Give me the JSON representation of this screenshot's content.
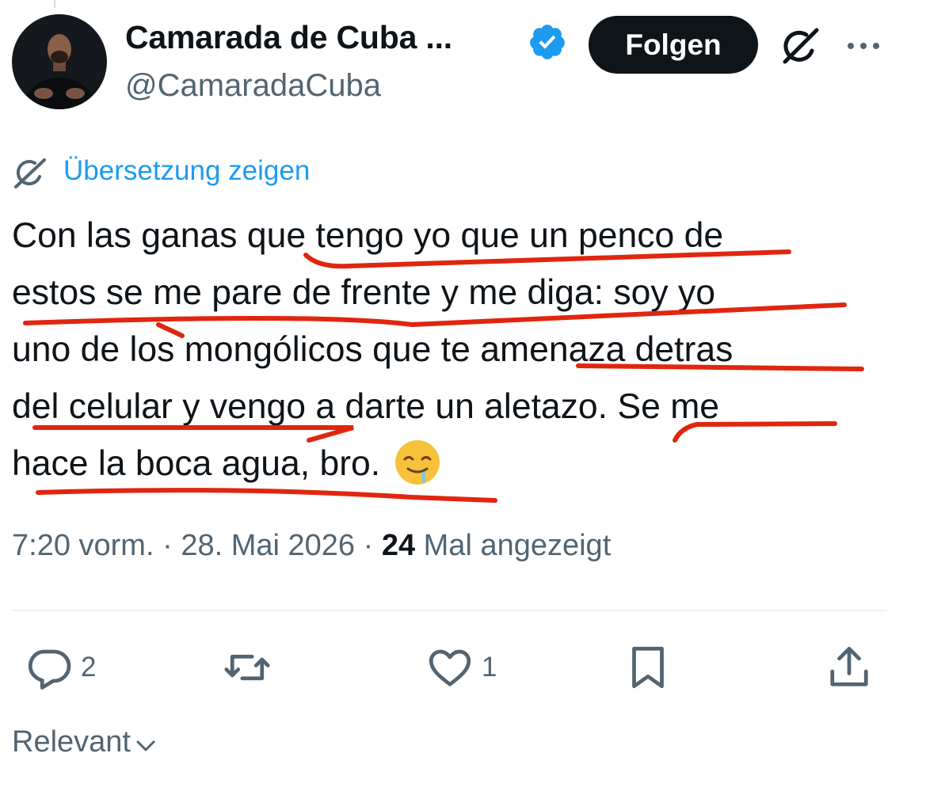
{
  "author": {
    "display_name": "Camarada de Cuba ...",
    "handle": "@CamaradaCuba",
    "verified": true
  },
  "follow_button": {
    "label": "Folgen"
  },
  "translate_link": "Übersetzung zeigen",
  "tweet": {
    "text": "Con las ganas que tengo yo que un penco de\nestos se me pare de frente y me diga: soy yo\nuno de los mongólicos que te amenaza detras\ndel celular y vengo a darte un aletazo. Se me\nhace la boca agua, bro.",
    "emoji": "drooling-face"
  },
  "meta": {
    "time": "7:20 vorm.",
    "separator": "·",
    "date": "28. Mai 2026",
    "views_count": "24",
    "views_label": "Mal angezeigt"
  },
  "actions": {
    "replies": "2",
    "retweets": "",
    "likes": "1"
  },
  "sort": {
    "label": "Relevant"
  },
  "colors": {
    "accent": "#1d9bf0",
    "text": "#0f1419",
    "secondary": "#536471",
    "annotation": "#e0260f"
  },
  "icons": [
    "verified-badge-icon",
    "grok-icon",
    "more-icon",
    "reply-icon",
    "retweet-icon",
    "like-icon",
    "bookmark-icon",
    "share-icon",
    "chevron-down-icon"
  ]
}
